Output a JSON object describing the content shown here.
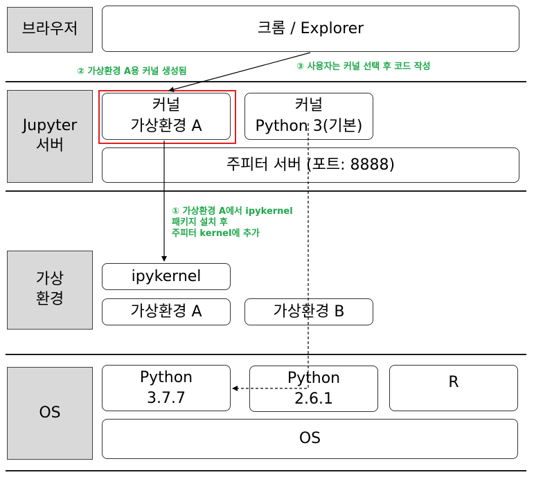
{
  "layers": {
    "browser": "브라우저",
    "jupyter": "Jupyter\n서버",
    "venv": "가상\n환경",
    "os": "OS"
  },
  "browser_box": "크롬 / Explorer",
  "jupyter": {
    "kernel_a": "커널\n가상환경 A",
    "kernel_default": "커널\nPython 3(기본)",
    "server": "주피터 서버 (포트: 8888)"
  },
  "venv": {
    "ipykernel": "ipykernel",
    "env_a": "가상환경 A",
    "env_b": "가상환경 B"
  },
  "os": {
    "python_377": "Python\n3.7.7",
    "python_261": "Python\n2.6.1",
    "r": "R",
    "os_box": "OS"
  },
  "notes": {
    "step1": "① 가상환경 A에서 ipykernel\n패키지 설치 후\n주피터 kernel에 추가",
    "step2": "② 가상환경 A용 커널 생성됨",
    "step3": "③ 사용자는 커널 선택 후 코드 작성"
  },
  "colors": {
    "note_green": "#1ea84a",
    "highlight_red": "#e02020",
    "layer_gray": "#d9d9d9"
  }
}
